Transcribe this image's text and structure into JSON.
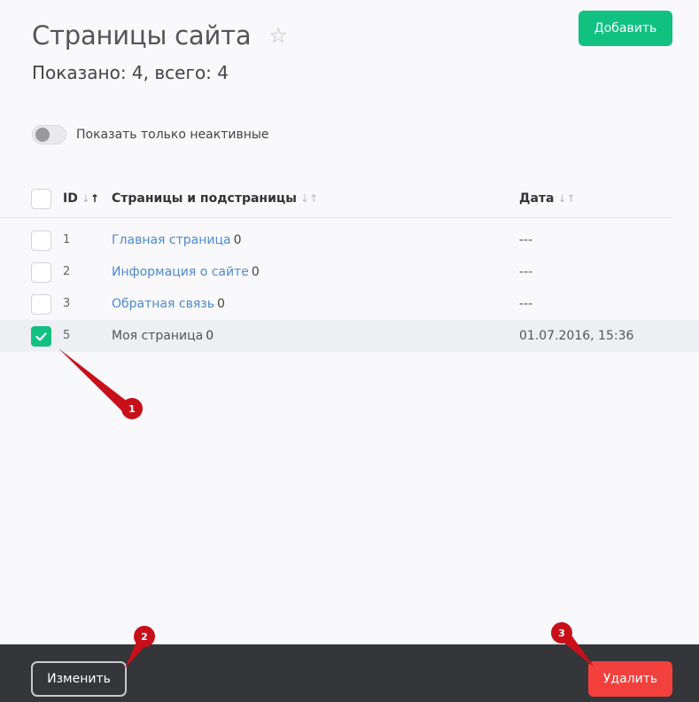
{
  "page": {
    "title": "Страницы сайта",
    "add_label": "Добавить",
    "count_text": "Показано: 4, всего: 4",
    "filter_label": "Показать только неактивные"
  },
  "table": {
    "headers": {
      "id": "ID",
      "name": "Страницы и подстраницы",
      "date": "Дата"
    },
    "rows": [
      {
        "id": "1",
        "name": "Главная страница",
        "count": "0",
        "date": "---",
        "link": true,
        "checked": false
      },
      {
        "id": "2",
        "name": "Информация о сайте",
        "count": "0",
        "date": "---",
        "link": true,
        "checked": false
      },
      {
        "id": "3",
        "name": "Обратная связь",
        "count": "0",
        "date": "---",
        "link": true,
        "checked": false
      },
      {
        "id": "5",
        "name": "Моя страница",
        "count": "0",
        "date": "01.07.2016, 15:36",
        "link": false,
        "checked": true
      }
    ]
  },
  "footer": {
    "edit_label": "Изменить",
    "delete_label": "Удалить"
  },
  "annotations": [
    "1",
    "2",
    "3"
  ],
  "colors": {
    "accent": "#11c182",
    "danger": "#f2403d",
    "link": "#4d8ad4",
    "marker": "#c8101a"
  }
}
